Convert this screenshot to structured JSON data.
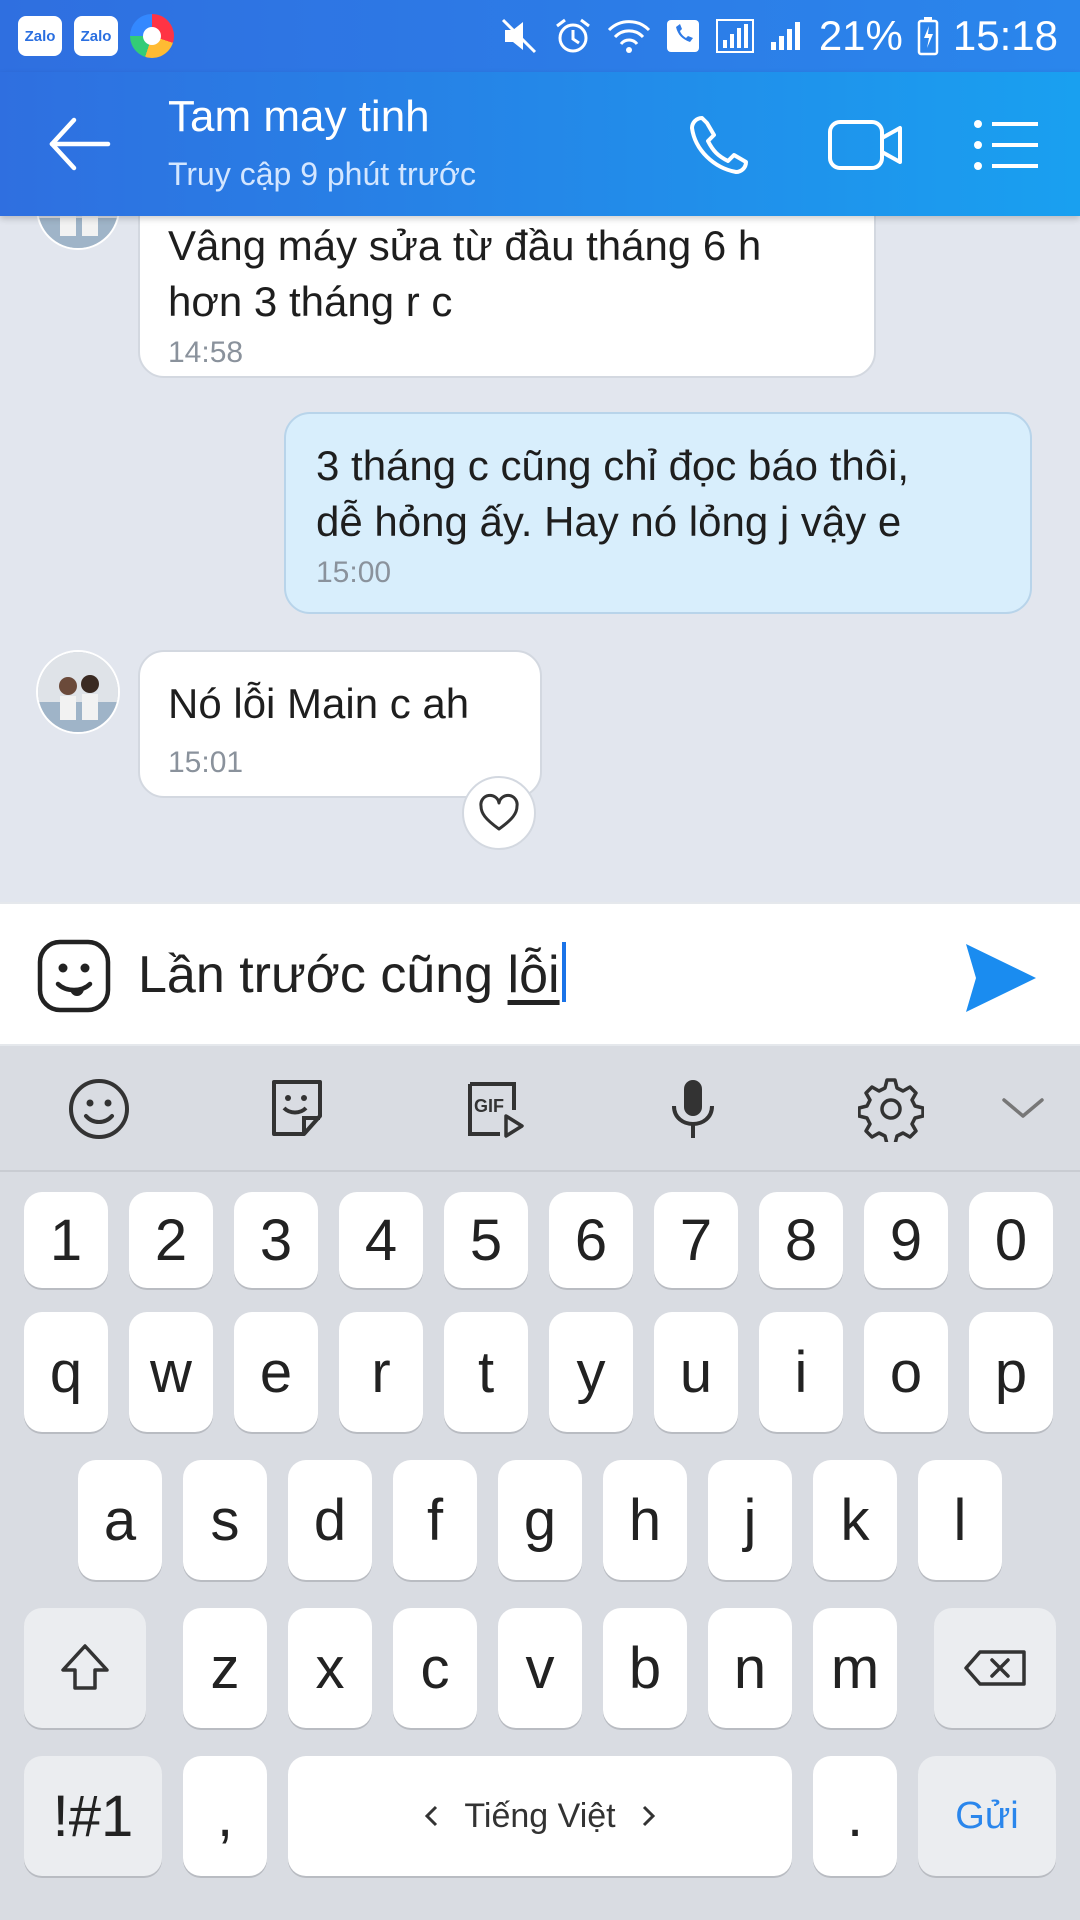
{
  "status_bar": {
    "left_icons": [
      "zalo",
      "zalo",
      "browser"
    ],
    "zalo_label": "Zalo",
    "battery": "21%",
    "time": "15:18"
  },
  "header": {
    "title": "Tam may tinh",
    "subtitle": "Truy cập 9 phút trước",
    "actions": [
      "phone-icon",
      "video-call-icon",
      "menu-icon"
    ]
  },
  "messages": [
    {
      "side": "in",
      "lines": [
        "Vâng máy sửa từ đầu tháng 6 h",
        "hơn 3 tháng r c"
      ],
      "time": "14:58"
    },
    {
      "side": "out",
      "lines": [
        "3 tháng c cũng chỉ đọc báo thôi,",
        "dễ hỏng ấy. Hay nó lỏng j vậy e"
      ],
      "time": "15:00"
    },
    {
      "side": "in",
      "lines": [
        "Nó lỗi Main c ah"
      ],
      "time": "15:01"
    }
  ],
  "composer": {
    "text_before": "Lần trước cũng ",
    "composing_word": "lỗi"
  },
  "keyboard": {
    "toolbar": [
      "emoji-icon",
      "sticker-icon",
      "gif-icon",
      "microphone-icon",
      "settings-icon",
      "collapse-icon"
    ],
    "gif_label": "GIF",
    "row_numbers": [
      "1",
      "2",
      "3",
      "4",
      "5",
      "6",
      "7",
      "8",
      "9",
      "0"
    ],
    "row1": [
      "q",
      "w",
      "e",
      "r",
      "t",
      "y",
      "u",
      "i",
      "o",
      "p"
    ],
    "row2": [
      "a",
      "s",
      "d",
      "f",
      "g",
      "h",
      "j",
      "k",
      "l"
    ],
    "row3": [
      "z",
      "x",
      "c",
      "v",
      "b",
      "n",
      "m"
    ],
    "symbols_label": "!#1",
    "comma_label": ",",
    "space_label": "Tiếng Việt",
    "period_label": ".",
    "enter_label": "Gửi"
  },
  "colors": {
    "header_start": "#2f6fe0",
    "header_end": "#19a0f0",
    "accent": "#1a8cf0",
    "outgoing_bubble": "#d8eefc"
  }
}
